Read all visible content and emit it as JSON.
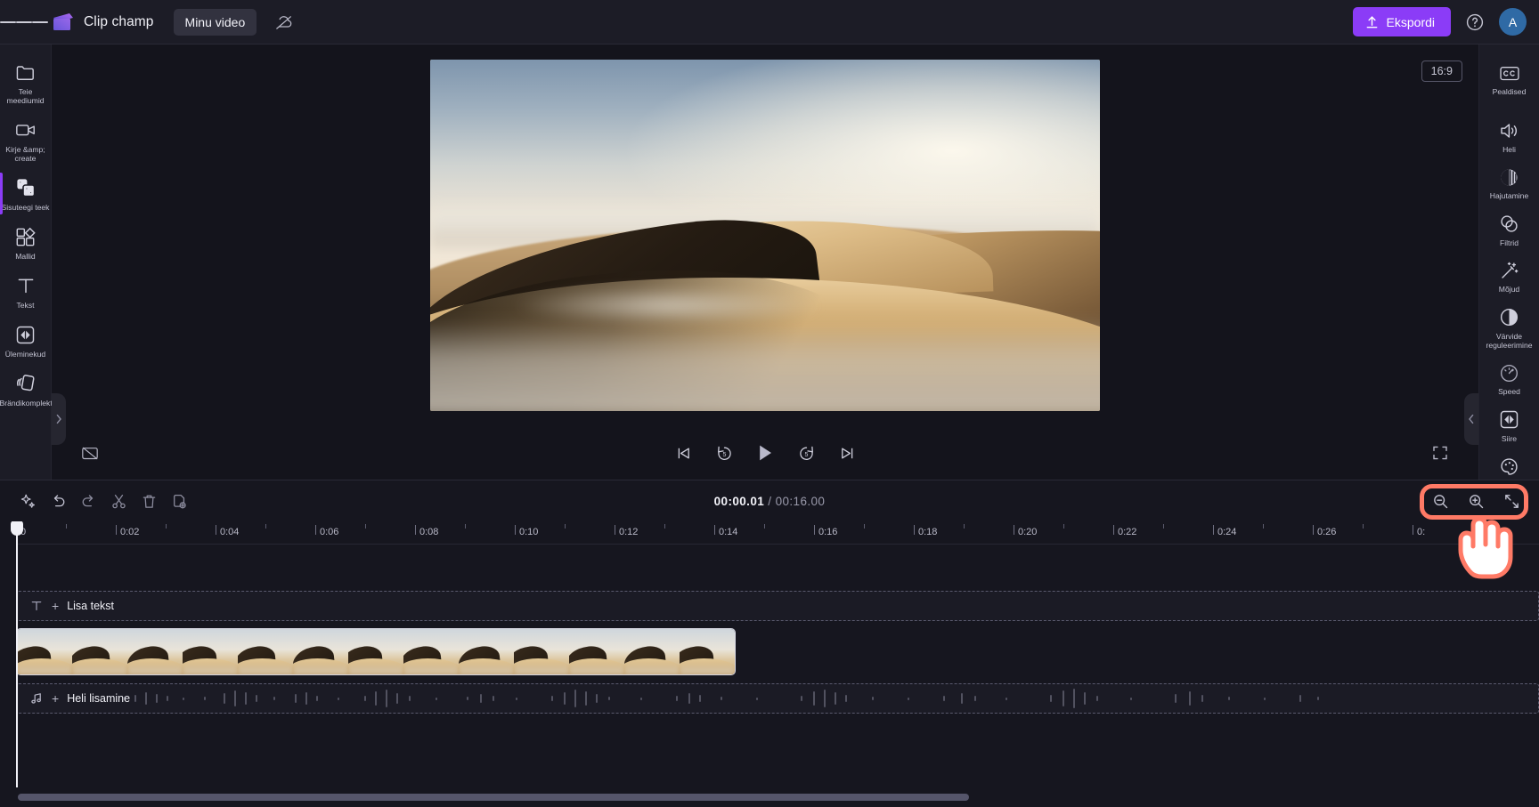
{
  "app": {
    "brand_name": "Clip champ",
    "project_name": "Minu video",
    "menu_icon": "hamburger-icon",
    "logo_icon": "clipchamp-logo-icon",
    "cloud_status_icon": "cloud-off-icon"
  },
  "topbar": {
    "export_label": "Ekspordi",
    "export_icon": "upload-icon",
    "help_icon": "help-circle-icon",
    "avatar_initial": "A",
    "accent_color": "#8b3cf7",
    "avatar_color": "#2f6aa5"
  },
  "left_rail": {
    "items": [
      {
        "label": "Teie meediumid",
        "icon": "folder-icon",
        "active": false
      },
      {
        "label": "Kirje &amp; create",
        "icon": "camera-icon",
        "active": false
      },
      {
        "label": "Sisuteegi teek",
        "icon": "content-library-icon",
        "active": true
      },
      {
        "label": "Mallid",
        "icon": "templates-icon",
        "active": false
      },
      {
        "label": "Tekst",
        "icon": "text-icon",
        "active": false
      },
      {
        "label": "Üleminekud",
        "icon": "transitions-icon",
        "active": false
      },
      {
        "label": "Brändikomplekt",
        "icon": "brand-kit-icon",
        "active": false
      }
    ]
  },
  "right_rail": {
    "items": [
      {
        "label": "Pealdised",
        "icon": "closed-caption-icon",
        "separator_after": true
      },
      {
        "label": "Heli",
        "icon": "speaker-icon",
        "separator_after": false
      },
      {
        "label": "Hajutamine",
        "icon": "fade-icon",
        "separator_after": false
      },
      {
        "label": "Filtrid",
        "icon": "filters-icon",
        "separator_after": false
      },
      {
        "label": "Mõjud",
        "icon": "effects-wand-icon",
        "separator_after": false
      },
      {
        "label": "Värvide reguleerimine",
        "icon": "color-adjust-icon",
        "separator_after": false
      },
      {
        "label": "Speed",
        "icon": "speedometer-icon",
        "separator_after": false
      },
      {
        "label": "Siire",
        "icon": "transition-icon",
        "separator_after": false
      },
      {
        "label": "Värv",
        "icon": "palette-icon",
        "separator_after": false
      }
    ]
  },
  "stage": {
    "aspect_ratio": "16:9",
    "collapse_left_icon": "chevron-right-icon",
    "collapse_right_icon": "chevron-left-icon"
  },
  "player": {
    "captions_icon": "captions-off-icon",
    "skip_start_icon": "skip-to-start-icon",
    "back5_icon": "rewind-5-icon",
    "play_icon": "play-icon",
    "forward5_icon": "forward-5-icon",
    "skip_end_icon": "skip-to-end-icon",
    "fullscreen_icon": "fullscreen-icon",
    "back5_label": "5",
    "forward5_label": "5"
  },
  "timeline": {
    "toolbar": [
      {
        "icon": "magic-sparkle-icon",
        "name": "auto-compose-button"
      },
      {
        "icon": "undo-icon",
        "name": "undo-button"
      },
      {
        "icon": "redo-icon",
        "name": "redo-button"
      },
      {
        "icon": "scissors-icon",
        "name": "split-button"
      },
      {
        "icon": "trash-icon",
        "name": "delete-button"
      },
      {
        "icon": "duplicate-icon",
        "name": "duplicate-button"
      }
    ],
    "current_time": "00:00.01",
    "time_separator": " / ",
    "total_time": "00:16.00",
    "zoom_out_icon": "zoom-out-icon",
    "zoom_in_icon": "zoom-in-icon",
    "fit_icon": "fit-to-screen-icon",
    "highlight_color": "#ff7a66",
    "ruler_labels": [
      "0",
      "0:02",
      "0:04",
      "0:06",
      "0:08",
      "0:10",
      "0:12",
      "0:14",
      "0:16",
      "0:18",
      "0:20",
      "0:22",
      "0:24",
      "0:26",
      "0:"
    ],
    "tracks": [
      {
        "kind": "text",
        "icon": "text-t-icon",
        "plus": "+",
        "label": "Lisa tekst"
      },
      {
        "kind": "video",
        "label": ""
      },
      {
        "kind": "audio",
        "icon": "music-note-icon",
        "plus": "+",
        "label": "Heli lisamine"
      }
    ]
  }
}
